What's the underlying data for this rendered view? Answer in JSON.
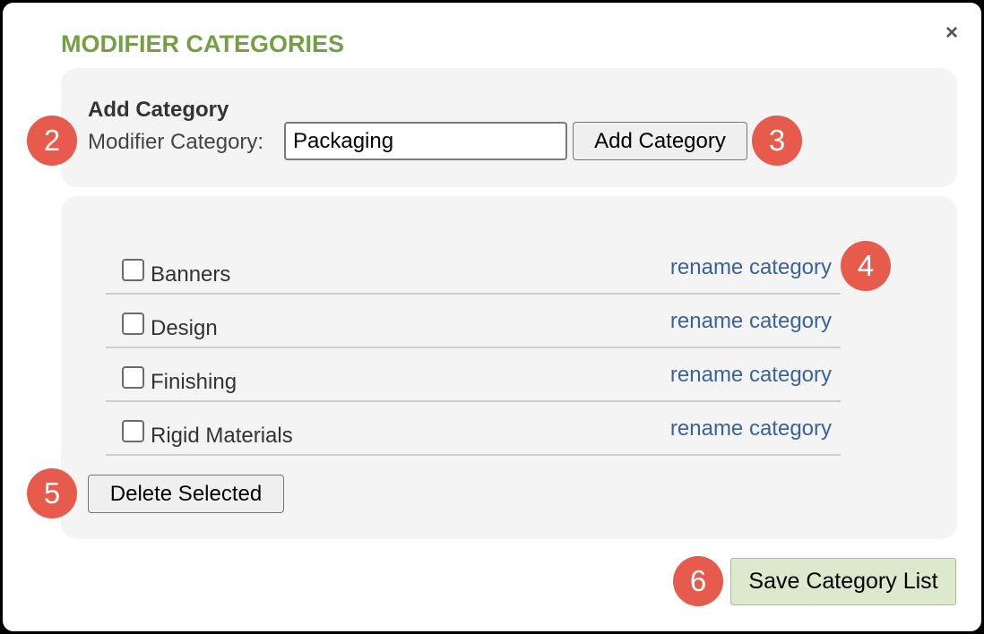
{
  "dialog": {
    "title": "MODIFIER CATEGORIES",
    "close_label": "×"
  },
  "add_section": {
    "heading": "Add Category",
    "field_label": "Modifier Category:",
    "field_value": "Packaging",
    "button_label": "Add Category"
  },
  "categories": {
    "items": [
      {
        "label": "Banners",
        "checked": false,
        "rename_label": "rename category"
      },
      {
        "label": "Design",
        "checked": false,
        "rename_label": "rename category"
      },
      {
        "label": "Finishing",
        "checked": false,
        "rename_label": "rename category"
      },
      {
        "label": "Rigid Materials",
        "checked": false,
        "rename_label": "rename category"
      }
    ],
    "delete_label": "Delete Selected"
  },
  "footer": {
    "save_label": "Save Category List"
  },
  "markers": [
    "2",
    "3",
    "4",
    "5",
    "6"
  ],
  "colors": {
    "title": "#73a044",
    "link": "#38649b",
    "marker": "#e75b4d",
    "save_button": "#dde9cc"
  }
}
